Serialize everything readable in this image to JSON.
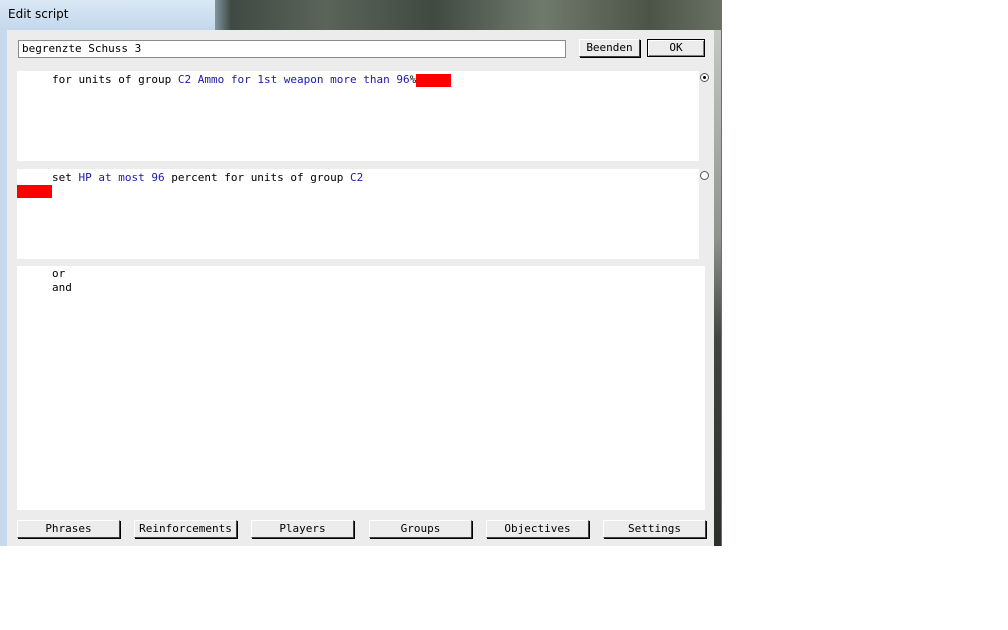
{
  "window": {
    "title": "Edit script"
  },
  "script_name": {
    "value": "begrenzte Schuss 3"
  },
  "buttons": {
    "beenden": "Beenden",
    "ok": "OK"
  },
  "conditions": {
    "prefix": "for units of group",
    "group": "C2",
    "detail": "Ammo for 1st weapon more than 96",
    "suffix": "%"
  },
  "actions": {
    "prefix": "set",
    "value_phrase": "HP at most 96",
    "middle": "percent for units of group",
    "group": "C2"
  },
  "operators": {
    "items": [
      "or",
      "and"
    ]
  },
  "tabs": [
    "Phrases",
    "Reinforcements",
    "Players",
    "Groups",
    "Objectives",
    "Settings"
  ],
  "colors": {
    "highlight_red": "#ff0000",
    "keyword_blue": "#1a1aa6"
  }
}
